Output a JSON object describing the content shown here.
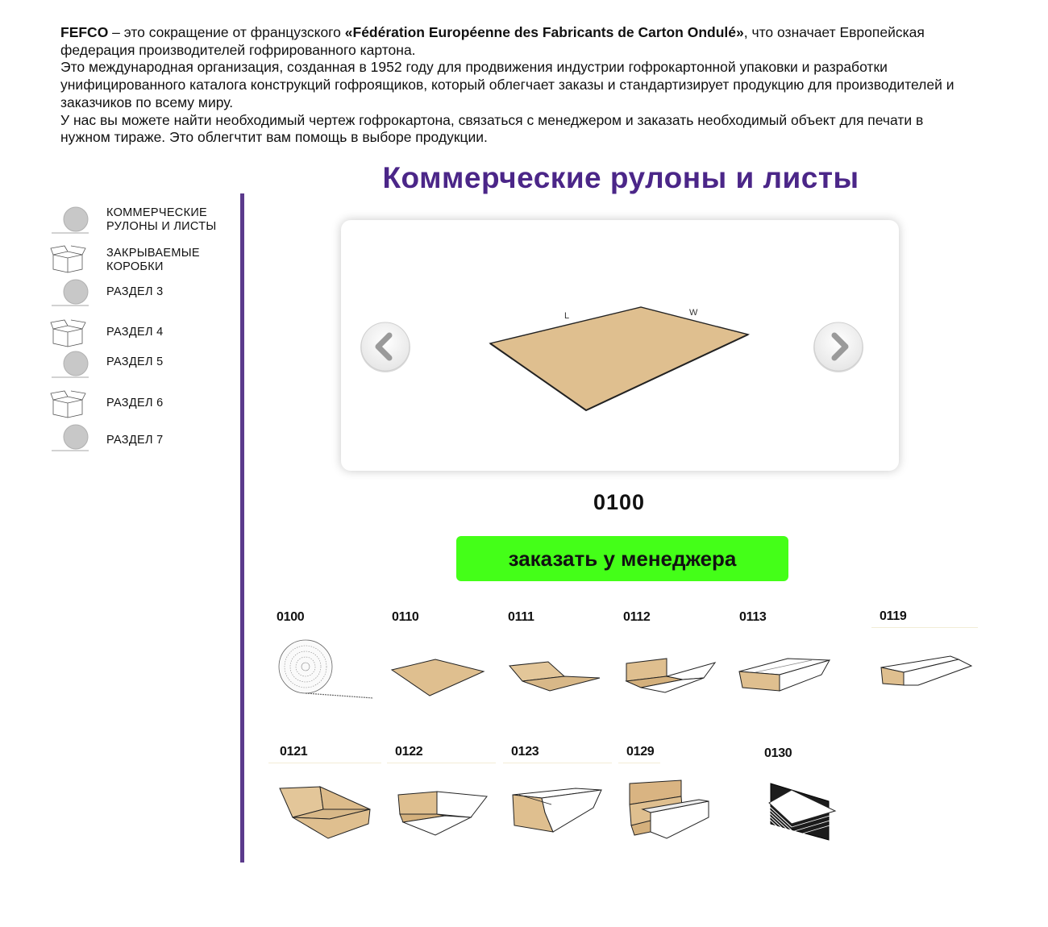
{
  "intro": {
    "line1_bold_start": "FEFCO",
    "line1_text": " – это сокращение от французского ",
    "line1_bold_quote": "«Fédération Européenne des Fabricants de Carton Ondulé»",
    "line1_end": ", что означает Европейская федерация производителей гофрированного картона.",
    "paragraph2": "Это международная организация, созданная в 1952 году для продвижения индустрии гофрокартонной упаковки и разработки унифицированного каталога конструкций гофроящиков, который облегчает заказы и стандартизирует продукцию для производителей и заказчиков по всему миру.",
    "paragraph3": "У нас вы можете найти необходимый чертеж гофрокартона, связаться с менеджером и заказать необходимый объект для печати в нужном тираже. Это облегчтит вам помощь в выборе продукции."
  },
  "sidebar": {
    "items": [
      {
        "label_line1": "Коммерческие",
        "label_line2": "рулоны и листы",
        "icon": "roll-icon"
      },
      {
        "label_line1": "Закрываемые",
        "label_line2": "коробки",
        "icon": "box-icon"
      },
      {
        "label_line1": "Раздел 3",
        "label_line2": "",
        "icon": "roll-icon"
      },
      {
        "label_line1": "Раздел 4",
        "label_line2": "",
        "icon": "box-icon"
      },
      {
        "label_line1": "Раздел 5",
        "label_line2": "",
        "icon": "roll-icon"
      },
      {
        "label_line1": "Раздел 6",
        "label_line2": "",
        "icon": "box-icon"
      },
      {
        "label_line1": "Раздел 7",
        "label_line2": "",
        "icon": "roll-icon"
      }
    ]
  },
  "main": {
    "title": "Коммерческие рулоны и листы",
    "slider": {
      "dimension_l": "L",
      "dimension_w": "W",
      "current_code": "0100"
    },
    "order_button": "заказать у менеджера",
    "thumbnails": [
      {
        "code": "0100"
      },
      {
        "code": "0110"
      },
      {
        "code": "0111"
      },
      {
        "code": "0112"
      },
      {
        "code": "0113"
      },
      {
        "code": "0119"
      },
      {
        "code": "0121"
      },
      {
        "code": "0122"
      },
      {
        "code": "0123"
      },
      {
        "code": "0129"
      },
      {
        "code": "0130"
      }
    ]
  },
  "colors": {
    "accent_purple": "#4b2688",
    "divider_purple": "#5b3a8c",
    "order_green": "#44ff18",
    "cardboard": "#dfbf8f",
    "cardboard_dark": "#cfa874"
  }
}
